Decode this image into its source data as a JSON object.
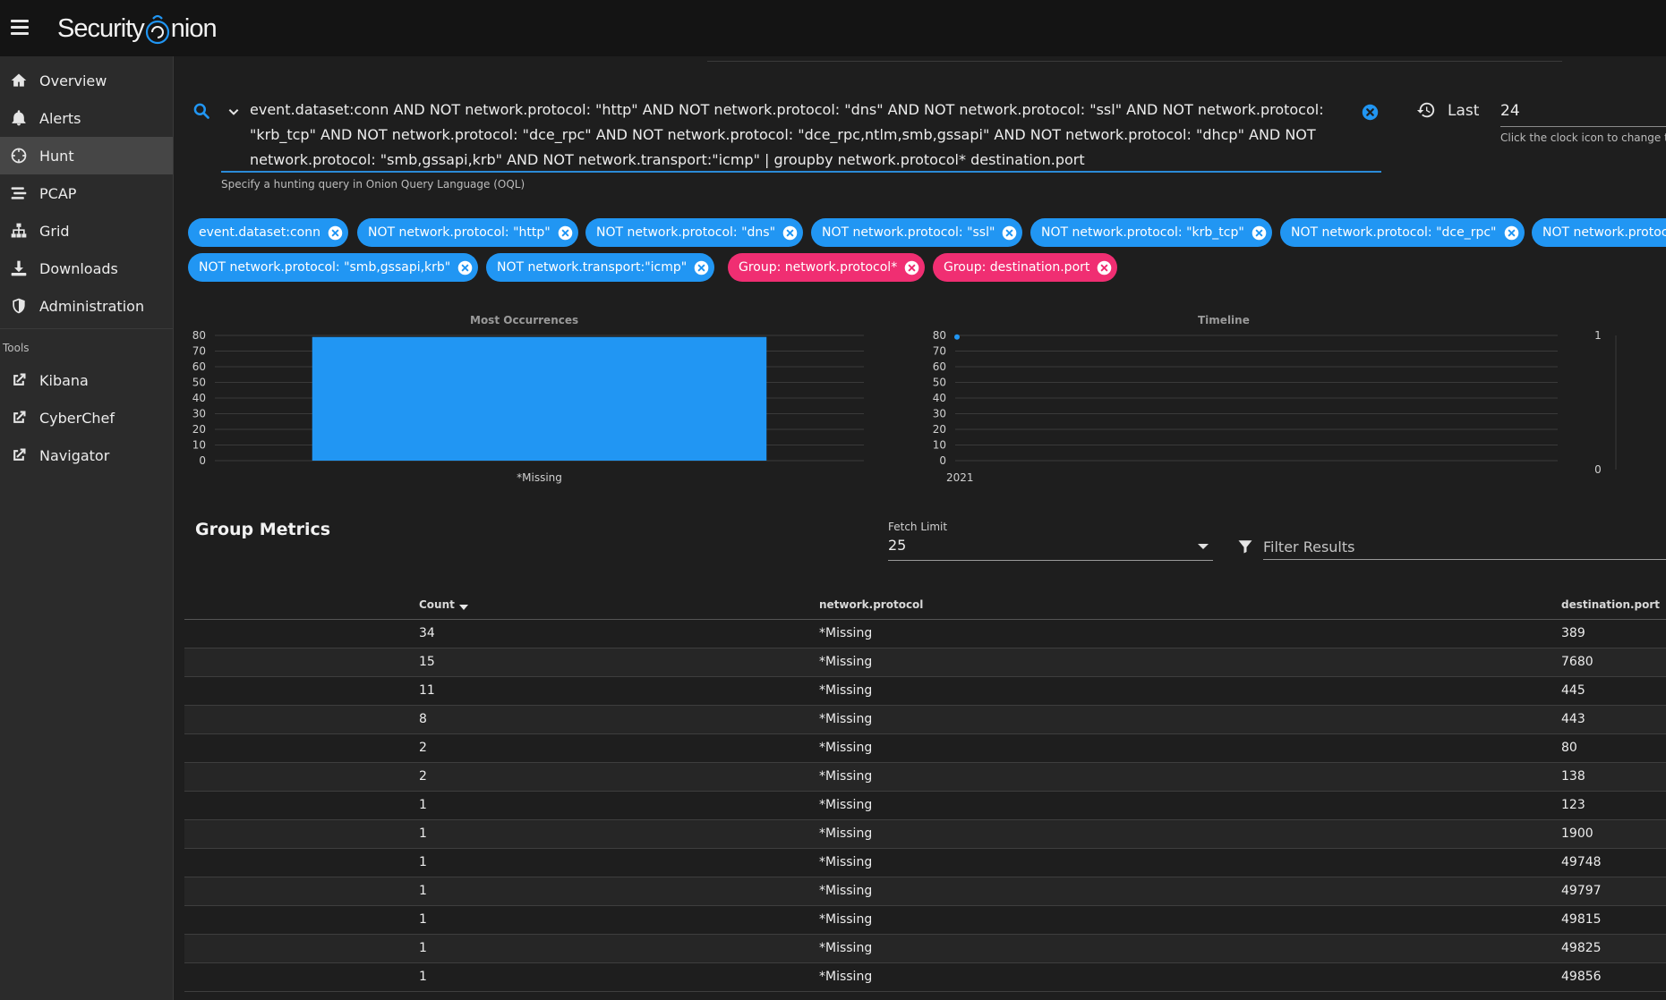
{
  "app": {
    "logo_text_a": "Security",
    "logo_text_b": "nion"
  },
  "sidebar": {
    "items": [
      {
        "label": "Overview",
        "icon": "home-icon"
      },
      {
        "label": "Alerts",
        "icon": "bell-icon"
      },
      {
        "label": "Hunt",
        "icon": "crosshairs-icon"
      },
      {
        "label": "PCAP",
        "icon": "stream-icon"
      },
      {
        "label": "Grid",
        "icon": "sitemap-icon"
      },
      {
        "label": "Downloads",
        "icon": "download-icon"
      },
      {
        "label": "Administration",
        "icon": "shield-icon"
      }
    ],
    "active": "Hunt",
    "tools_label": "Tools",
    "tools": [
      {
        "label": "Kibana",
        "icon": "external-link-icon"
      },
      {
        "label": "CyberChef",
        "icon": "external-link-icon"
      },
      {
        "label": "Navigator",
        "icon": "external-link-icon"
      }
    ]
  },
  "query": {
    "line1": "event.dataset:conn AND NOT network.protocol: \"http\" AND NOT network.protocol: \"dns\" AND NOT network.protocol: \"ssl\" AND NOT network.protocol:",
    "line2": "\"krb_tcp\" AND NOT network.protocol: \"dce_rpc\" AND NOT network.protocol: \"dce_rpc,ntlm,smb,gssapi\" AND NOT network.protocol: \"dhcp\" AND NOT",
    "line3": "network.protocol: \"smb,gssapi,krb\" AND NOT network.transport:\"icmp\" | groupby network.protocol* destination.port",
    "hint": "Specify a hunting query in Onion Query Language (OQL)"
  },
  "time": {
    "last_label": "Last",
    "last_value": "24",
    "hint": "Click the clock icon to change t"
  },
  "chips": {
    "row1": [
      "event.dataset:conn",
      "NOT network.protocol: \"http\"",
      "NOT network.protocol: \"dns\"",
      "NOT network.protocol: \"ssl\"",
      "NOT network.protocol: \"krb_tcp\"",
      "NOT network.protocol: \"dce_rpc\"",
      "NOT network.protoc"
    ],
    "row2_blue": [
      "NOT network.protocol: \"smb,gssapi,krb\"",
      "NOT network.transport:\"icmp\""
    ],
    "row2_pink": [
      "Group: network.protocol*",
      "Group: destination.port"
    ],
    "blue_color": "#2196f3",
    "pink_color": "#f02e72"
  },
  "chart_data": [
    {
      "type": "bar",
      "title": "Most Occurrences",
      "categories": [
        "*Missing"
      ],
      "values": [
        79
      ],
      "ylim": [
        0,
        80
      ],
      "yticks": [
        0,
        10,
        20,
        30,
        40,
        50,
        60,
        70,
        80
      ],
      "color": "#2196f3",
      "grid": true
    },
    {
      "type": "scatter",
      "title": "Timeline",
      "x": [
        "2021"
      ],
      "values": [
        79
      ],
      "ylim": [
        0,
        80
      ],
      "yticks": [
        0,
        10,
        20,
        30,
        40,
        50,
        60,
        70,
        80
      ],
      "xticks": [
        "2021"
      ],
      "color": "#2196f3",
      "grid": true
    },
    {
      "type": "line",
      "title": "",
      "values": [],
      "ylim": [
        0,
        1
      ],
      "yticks": [
        0,
        1
      ]
    }
  ],
  "metrics": {
    "title": "Group Metrics",
    "fetch_label": "Fetch Limit",
    "fetch_value": "25",
    "filter_placeholder": "Filter Results",
    "columns": [
      "Count",
      "network.protocol",
      "destination.port"
    ],
    "rows": [
      [
        "34",
        "*Missing",
        "389"
      ],
      [
        "15",
        "*Missing",
        "7680"
      ],
      [
        "11",
        "*Missing",
        "445"
      ],
      [
        "8",
        "*Missing",
        "443"
      ],
      [
        "2",
        "*Missing",
        "80"
      ],
      [
        "2",
        "*Missing",
        "138"
      ],
      [
        "1",
        "*Missing",
        "123"
      ],
      [
        "1",
        "*Missing",
        "1900"
      ],
      [
        "1",
        "*Missing",
        "49748"
      ],
      [
        "1",
        "*Missing",
        "49797"
      ],
      [
        "1",
        "*Missing",
        "49815"
      ],
      [
        "1",
        "*Missing",
        "49825"
      ],
      [
        "1",
        "*Missing",
        "49856"
      ]
    ]
  }
}
